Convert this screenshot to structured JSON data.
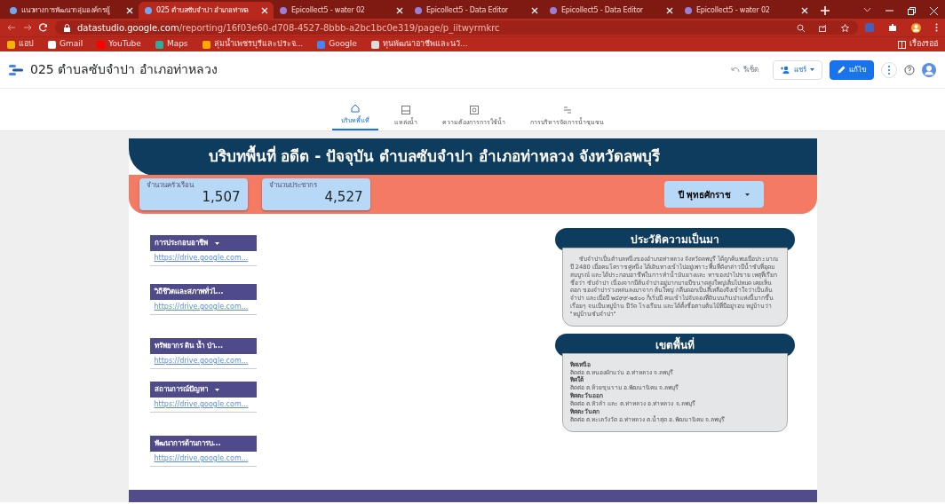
{
  "browser": {
    "tabs": [
      {
        "title": "แนวทางการพัฒนากลุ่มองค์กรผู้",
        "selected": false
      },
      {
        "title": "025 ตำบลซับจำปา อำเภอท่าหล",
        "selected": true
      },
      {
        "title": "Epicollect5 - water 02",
        "selected": false
      },
      {
        "title": "Epicollect5 - Data Editor",
        "selected": false
      },
      {
        "title": "Epicollect5 - Data Editor",
        "selected": false
      },
      {
        "title": "Epicollect5 - water 02",
        "selected": false
      }
    ],
    "url_host": "datastudio.google.com",
    "url_path": "/reporting/16f03e60-d708-4527-8bbb-a2bc1bc0e319/page/p_iitwyrmkrc",
    "bookmarks": [
      "แอป",
      "Gmail",
      "YouTube",
      "Maps",
      "ลุ่มน้ำเพชรบุรีและประจ...",
      "Google",
      "ทุนพัฒนาอาชีพและนวั..."
    ],
    "reading_list": "เรื่องรออ่"
  },
  "report": {
    "title": "025 ตำบลซับจำปา อำเภอท่าหลวง",
    "reset": "รีเซ็ต",
    "share": "แชร์",
    "edit": "แก้ไข",
    "pages": [
      {
        "label": "บริบทพื้นที่",
        "selected": true
      },
      {
        "label": "แหล่งน้ำ",
        "selected": false
      },
      {
        "label": "ความต้องการการใช้น้ำ",
        "selected": false
      },
      {
        "label": "การบริหารจัดการน้ำชุมชน",
        "selected": false
      }
    ]
  },
  "canvas": {
    "heading": "บริบทพื้นที่ อดีต - ปัจจุบัน ตำบลซับจำปา อำเภอท่าหลวง จังหวัดลพบุรี",
    "scorecards": [
      {
        "label": "จำนวนครัวเรือน",
        "value": "1,507"
      },
      {
        "label": "จำนวนประชากร",
        "value": "4,527"
      }
    ],
    "year_filter": "ปี พุทธศักราช",
    "links": [
      {
        "title": "การประกอบอาชีพ",
        "dropdown": true,
        "url": "https://drive.google.com..."
      },
      {
        "title": "วิถีชีวิตและสภาพทั่วไ...",
        "dropdown": false,
        "url": "https://drive.google.com..."
      },
      {
        "title": "ทรัพยากร ดิน น้ำ ป่า...",
        "dropdown": false,
        "url": "https://drive.google.com..."
      },
      {
        "title": "สถานการณ์ปัญหา",
        "dropdown": true,
        "url": "https://drive.google.com..."
      },
      {
        "title": "พัฒนาการด้านการบ...",
        "dropdown": false,
        "url": "https://drive.google.com..."
      }
    ],
    "history": {
      "title": "ประวัติความเป็นมา",
      "text": "ซับจำปาเป็นตำบลหนึ่งของอำเภอท่าหลวง จังหวัดลพบุรี ได้ถูกค้นพบเมื่อประมาณปี 2480 เมื่อคนโคราชคู่หนึ่ง ได้เดินทางเข้าไปอยู่เพราะพื้นที่ดังกล่าวมีน้ำซับที่อุดมสมบูรณ์ และได้ประกอบอาชีพในการทำน้ำมันยางและ หาของป่าไปขาย เหตุที่เรียกชื่อว่า ซับจำปา เนื่องจากมีต้นจำปาอยู่มากมายมีขนาดสูงใหญ่เต็มไปหมด เคยเห็นดอก ของจำปาร่วงหล่นลงมาจาก ต้นใหญ่ กลีบดอกเป็นสีเหลืองจึงเข้าใจว่าเป็นต้นจำปา และเมื่อปี ๒๔๙๙-๒๕๐๐ ก็เริ่มมี คนเข้าไปจับจองที่ดินบนกินป่าแห่งนี้มากขึ้นเรื่อยๆ จนเป็นหมู่บ้าน มีวัด โรงเรียน และได้ตั้งชื่อตามต้นไม้ที่มีอยู่รอบ หมู่บ้านว่า \"หมู่บ้านซับจำปา\""
    },
    "boundary": {
      "title": "เขตพื้นที่",
      "sides": [
        {
          "direction": "ทิศเหนือ",
          "text": "ติดต่อ ต.หนองผักแว่น อ.ท่าหลวง จ.ลพบุรี"
        },
        {
          "direction": "ทิศใต้",
          "text": "ติดต่อ ต.ห้วยขุนราม อ.พัฒนานิคม จ.ลพบุรี"
        },
        {
          "direction": "ทิศตะวันออก",
          "text": "ติดต่อ ต.หัวลำ และ ต.ท่าหลวง อ.ท่าหลวง จ.ลพบุรี"
        },
        {
          "direction": "ทิศตะวันตก",
          "text": "ติดต่อ ต.ทะเลวังวัด อ.ท่าหลวง ต.น้ำสุด อ.พัฒนานิคม จ.ลพบุรี"
        }
      ]
    }
  }
}
